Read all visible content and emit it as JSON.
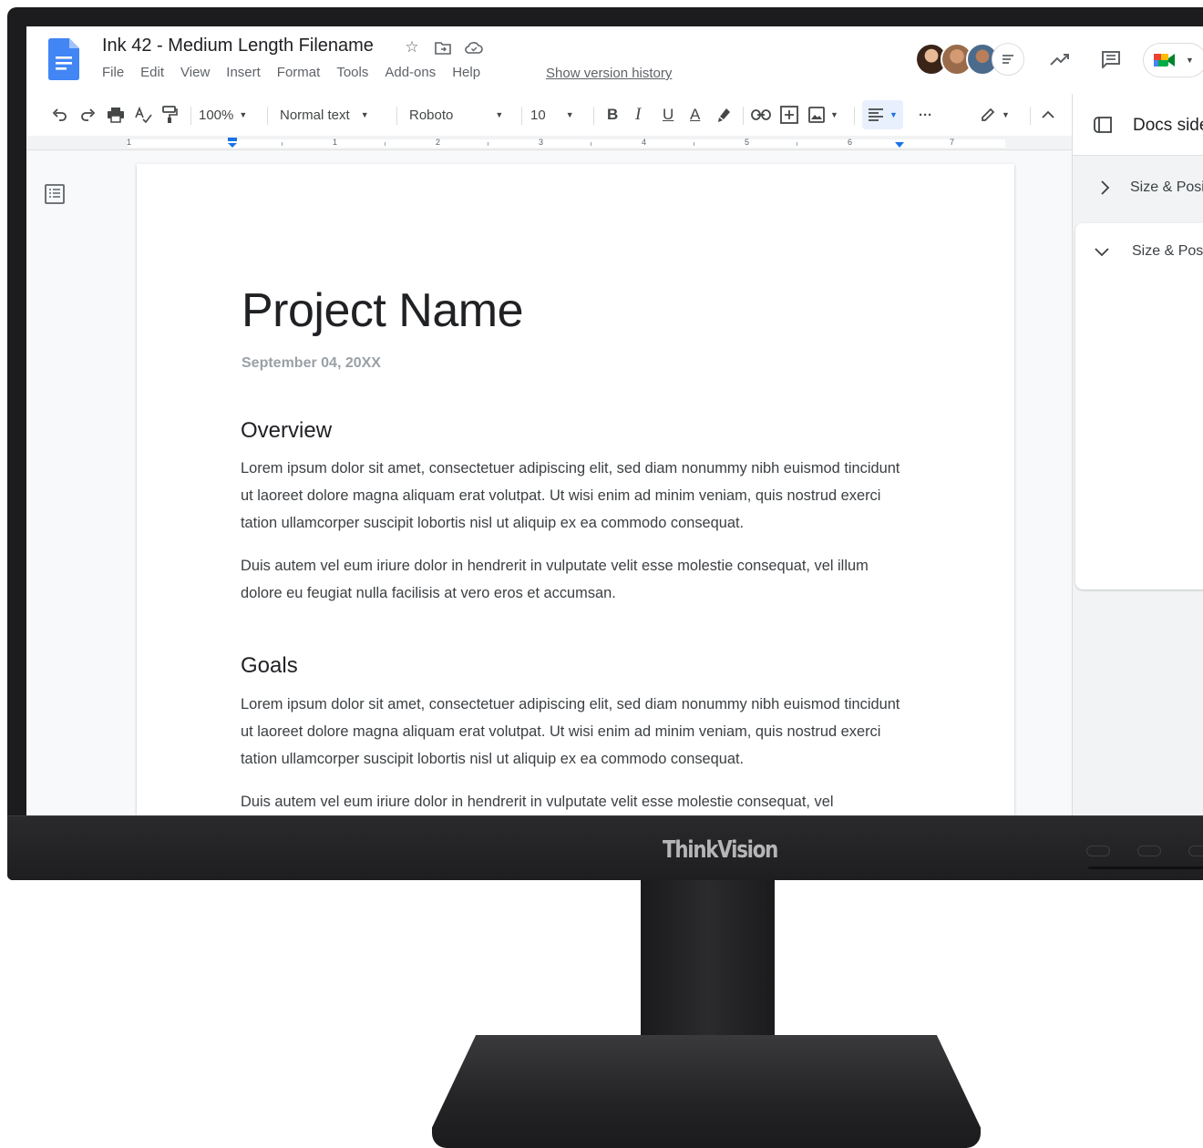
{
  "document": {
    "title": "Ink 42 - Medium Length Filename",
    "menu": [
      "File",
      "Edit",
      "View",
      "Insert",
      "Format",
      "Tools",
      "Add-ons",
      "Help"
    ],
    "version_history_link": "Show version history"
  },
  "header": {
    "collaborators": [
      "collaborator-1",
      "collaborator-2",
      "collaborator-3"
    ],
    "icons": [
      "activity-trend-icon",
      "comments-icon",
      "meet-icon"
    ]
  },
  "toolbar": {
    "zoom": "100%",
    "style": "Normal text",
    "font": "Roboto",
    "font_size": "10",
    "bold": "B",
    "italic": "I",
    "underline": "U",
    "text_color": "A",
    "more": "···"
  },
  "ruler": {
    "numbers": [
      "1",
      "1",
      "2",
      "3",
      "4",
      "5",
      "6",
      "7"
    ]
  },
  "page": {
    "title": "Project Name",
    "date": "September 04, 20XX",
    "sections": [
      {
        "heading": "Overview",
        "paragraphs": [
          "Lorem ipsum dolor sit amet, consectetuer adipiscing elit, sed diam nonummy nibh euismod tincidunt ut laoreet dolore magna aliquam erat volutpat. Ut wisi enim ad minim veniam, quis nostrud exerci tation ullamcorper suscipit lobortis nisl ut aliquip ex ea commodo consequat.",
          "Duis autem vel eum iriure dolor in hendrerit in vulputate velit esse molestie consequat, vel illum dolore eu feugiat nulla facilisis at vero eros et accumsan."
        ]
      },
      {
        "heading": "Goals",
        "paragraphs": [
          "Lorem ipsum dolor sit amet, consectetuer adipiscing elit, sed diam nonummy nibh euismod tincidunt ut laoreet dolore magna aliquam erat volutpat. Ut wisi enim ad minim veniam, quis nostrud exerci tation ullamcorper suscipit lobortis nisl ut aliquip ex ea commodo consequat.",
          "Duis autem vel eum iriure dolor in hendrerit in vulputate velit esse molestie consequat, vel"
        ]
      }
    ]
  },
  "side_panel": {
    "title": "Docs side",
    "row_collapsed": "Size & Posi",
    "row_expanded": "Size & Pos"
  },
  "monitor": {
    "brand_prefix": "Thin",
    "brand_suffix": "kVision"
  },
  "colors": {
    "docs_blue": "#4285f4",
    "accent_blue": "#1a73e8",
    "bezel": "#1c1c1e",
    "brand_red": "#c8102e"
  }
}
